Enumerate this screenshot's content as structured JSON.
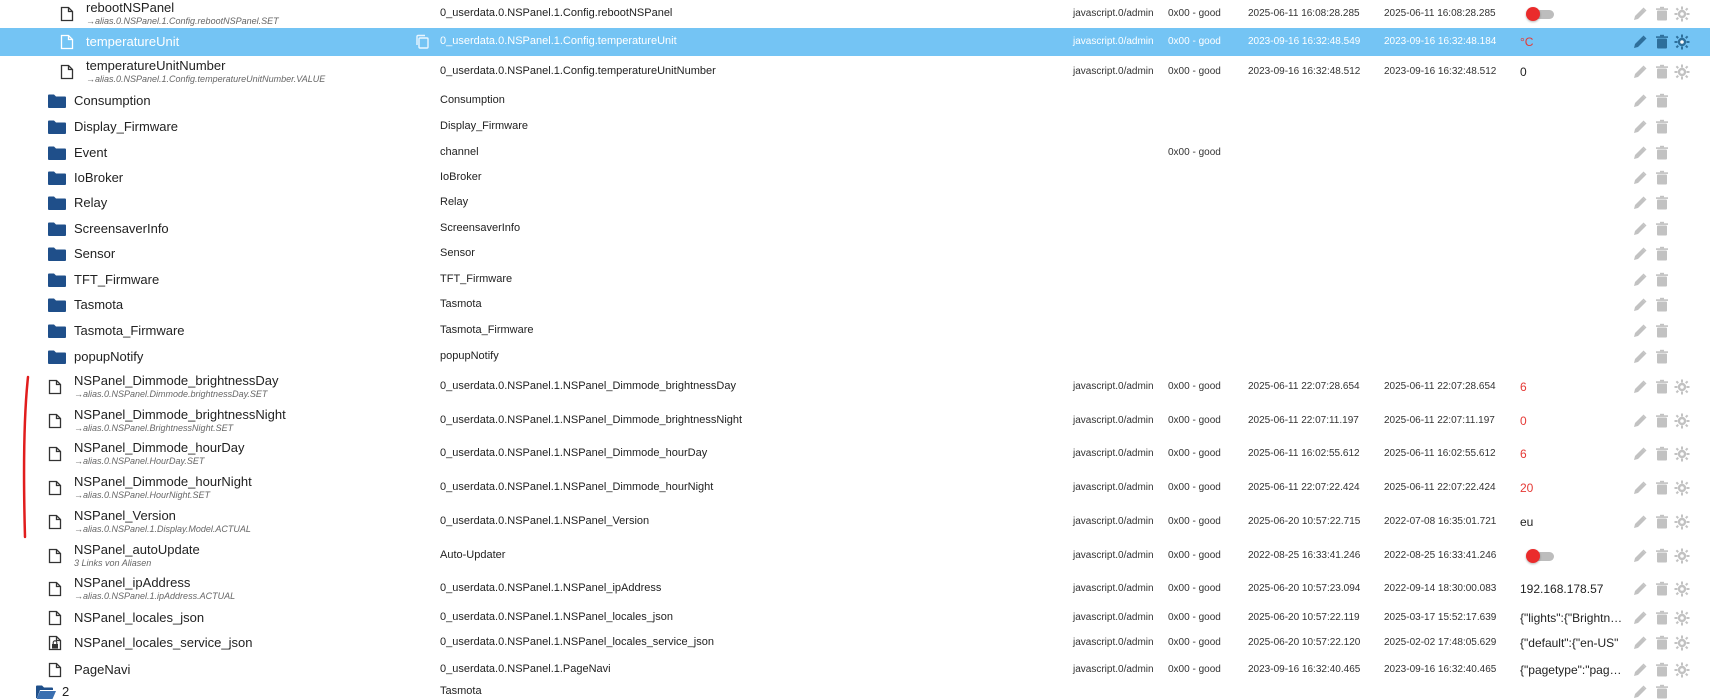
{
  "rows": [
    {
      "kind": "file",
      "level": 2,
      "name": "rebootNSPanel",
      "alias": "→alias.0.NSPanel.1.Config.rebootNSPanel.SET",
      "objid": "0_userdata.0.NSPanel.1.Config.rebootNSPanel",
      "user": "javascript.0/admin",
      "quality": "0x00 - good",
      "ts": "2025-06-11 16:08:28.285",
      "lc": "2025-06-11 16:08:28.285",
      "value": "",
      "value_type": "toggle",
      "cfg": true
    },
    {
      "kind": "file",
      "level": 2,
      "name": "temperatureUnit",
      "alias": "",
      "objid": "0_userdata.0.NSPanel.1.Config.temperatureUnit",
      "user": "javascript.0/admin",
      "quality": "0x00 - good",
      "ts": "2023-09-16 16:32:48.549",
      "lc": "2023-09-16 16:32:48.184",
      "value": "°C",
      "value_type": "red",
      "cfg": true,
      "selected": true
    },
    {
      "kind": "file",
      "level": 2,
      "name": "temperatureUnitNumber",
      "alias": "→alias.0.NSPanel.1.Config.temperatureUnitNumber.VALUE",
      "objid": "0_userdata.0.NSPanel.1.Config.temperatureUnitNumber",
      "user": "javascript.0/admin",
      "quality": "0x00 - good",
      "ts": "2023-09-16 16:32:48.512",
      "lc": "2023-09-16 16:32:48.512",
      "value": "0",
      "value_type": "plain",
      "cfg": true
    },
    {
      "kind": "folder",
      "level": 1,
      "name": "Consumption",
      "alias": "",
      "objid": "Consumption",
      "user": "",
      "quality": "",
      "ts": "",
      "lc": "",
      "value": "",
      "value_type": "none",
      "cfg": false
    },
    {
      "kind": "folder",
      "level": 1,
      "name": "Display_Firmware",
      "alias": "",
      "objid": "Display_Firmware",
      "user": "",
      "quality": "",
      "ts": "",
      "lc": "",
      "value": "",
      "value_type": "none",
      "cfg": false
    },
    {
      "kind": "folder",
      "level": 1,
      "name": "Event",
      "alias": "",
      "objid": "channel",
      "user": "",
      "quality": "0x00 - good",
      "ts": "",
      "lc": "",
      "value": "",
      "value_type": "none",
      "cfg": false
    },
    {
      "kind": "folder",
      "level": 1,
      "name": "IoBroker",
      "alias": "",
      "objid": "IoBroker",
      "user": "",
      "quality": "",
      "ts": "",
      "lc": "",
      "value": "",
      "value_type": "none",
      "cfg": false
    },
    {
      "kind": "folder",
      "level": 1,
      "name": "Relay",
      "alias": "",
      "objid": "Relay",
      "user": "",
      "quality": "",
      "ts": "",
      "lc": "",
      "value": "",
      "value_type": "none",
      "cfg": false
    },
    {
      "kind": "folder",
      "level": 1,
      "name": "ScreensaverInfo",
      "alias": "",
      "objid": "ScreensaverInfo",
      "user": "",
      "quality": "",
      "ts": "",
      "lc": "",
      "value": "",
      "value_type": "none",
      "cfg": false
    },
    {
      "kind": "folder",
      "level": 1,
      "name": "Sensor",
      "alias": "",
      "objid": "Sensor",
      "user": "",
      "quality": "",
      "ts": "",
      "lc": "",
      "value": "",
      "value_type": "none",
      "cfg": false
    },
    {
      "kind": "folder",
      "level": 1,
      "name": "TFT_Firmware",
      "alias": "",
      "objid": "TFT_Firmware",
      "user": "",
      "quality": "",
      "ts": "",
      "lc": "",
      "value": "",
      "value_type": "none",
      "cfg": false
    },
    {
      "kind": "folder",
      "level": 1,
      "name": "Tasmota",
      "alias": "",
      "objid": "Tasmota",
      "user": "",
      "quality": "",
      "ts": "",
      "lc": "",
      "value": "",
      "value_type": "none",
      "cfg": false
    },
    {
      "kind": "folder",
      "level": 1,
      "name": "Tasmota_Firmware",
      "alias": "",
      "objid": "Tasmota_Firmware",
      "user": "",
      "quality": "",
      "ts": "",
      "lc": "",
      "value": "",
      "value_type": "none",
      "cfg": false
    },
    {
      "kind": "folder",
      "level": 1,
      "name": "popupNotify",
      "alias": "",
      "objid": "popupNotify",
      "user": "",
      "quality": "",
      "ts": "",
      "lc": "",
      "value": "",
      "value_type": "none",
      "cfg": false
    },
    {
      "kind": "file",
      "level": 1,
      "name": "NSPanel_Dimmode_brightnessDay",
      "alias": "→alias.0.NSPanel.Dimmode.brightnessDay.SET",
      "objid": "0_userdata.0.NSPanel.1.NSPanel_Dimmode_brightnessDay",
      "user": "javascript.0/admin",
      "quality": "0x00 - good",
      "ts": "2025-06-11 22:07:28.654",
      "lc": "2025-06-11 22:07:28.654",
      "value": "6",
      "value_type": "red",
      "cfg": true
    },
    {
      "kind": "file",
      "level": 1,
      "name": "NSPanel_Dimmode_brightnessNight",
      "alias": "→alias.0.NSPanel.BrightnessNight.SET",
      "objid": "0_userdata.0.NSPanel.1.NSPanel_Dimmode_brightnessNight",
      "user": "javascript.0/admin",
      "quality": "0x00 - good",
      "ts": "2025-06-11 22:07:11.197",
      "lc": "2025-06-11 22:07:11.197",
      "value": "0",
      "value_type": "red",
      "cfg": true
    },
    {
      "kind": "file",
      "level": 1,
      "name": "NSPanel_Dimmode_hourDay",
      "alias": "→alias.0.NSPanel.HourDay.SET",
      "objid": "0_userdata.0.NSPanel.1.NSPanel_Dimmode_hourDay",
      "user": "javascript.0/admin",
      "quality": "0x00 - good",
      "ts": "2025-06-11 16:02:55.612",
      "lc": "2025-06-11 16:02:55.612",
      "value": "6",
      "value_type": "red",
      "cfg": true
    },
    {
      "kind": "file",
      "level": 1,
      "name": "NSPanel_Dimmode_hourNight",
      "alias": "→alias.0.NSPanel.HourNight.SET",
      "objid": "0_userdata.0.NSPanel.1.NSPanel_Dimmode_hourNight",
      "user": "javascript.0/admin",
      "quality": "0x00 - good",
      "ts": "2025-06-11 22:07:22.424",
      "lc": "2025-06-11 22:07:22.424",
      "value": "20",
      "value_type": "red",
      "cfg": true
    },
    {
      "kind": "file",
      "level": 1,
      "name": "NSPanel_Version",
      "alias": "→alias.0.NSPanel.1.Display.Model.ACTUAL",
      "objid": "0_userdata.0.NSPanel.1.NSPanel_Version",
      "user": "javascript.0/admin",
      "quality": "0x00 - good",
      "ts": "2025-06-20 10:57:22.715",
      "lc": "2022-07-08 16:35:01.721",
      "value": "eu",
      "value_type": "plain",
      "cfg": true
    },
    {
      "kind": "file",
      "level": 1,
      "name": "NSPanel_autoUpdate",
      "alias": "3 Links von Aliasen",
      "objid": "Auto-Updater",
      "user": "javascript.0/admin",
      "quality": "0x00 - good",
      "ts": "2022-08-25 16:33:41.246",
      "lc": "2022-08-25 16:33:41.246",
      "value": "",
      "value_type": "toggle",
      "cfg": true
    },
    {
      "kind": "file",
      "level": 1,
      "name": "NSPanel_ipAddress",
      "alias": "→alias.0.NSPanel.1.ipAddress.ACTUAL",
      "objid": "0_userdata.0.NSPanel.1.NSPanel_ipAddress",
      "user": "javascript.0/admin",
      "quality": "0x00 - good",
      "ts": "2025-06-20 10:57:23.094",
      "lc": "2022-09-14 18:30:00.083",
      "value": "192.168.178.57",
      "value_type": "plain",
      "cfg": true
    },
    {
      "kind": "file",
      "level": 1,
      "name": "NSPanel_locales_json",
      "alias": "",
      "objid": "0_userdata.0.NSPanel.1.NSPanel_locales_json",
      "user": "javascript.0/admin",
      "quality": "0x00 - good",
      "ts": "2025-06-20 10:57:22.119",
      "lc": "2025-03-17 15:52:17.639",
      "value": "{\"lights\":{\"Brightness",
      "value_type": "plain",
      "cfg": true
    },
    {
      "kind": "file-lock",
      "level": 1,
      "name": "NSPanel_locales_service_json",
      "alias": "",
      "objid": "0_userdata.0.NSPanel.1.NSPanel_locales_service_json",
      "user": "javascript.0/admin",
      "quality": "0x00 - good",
      "ts": "2025-06-20 10:57:22.120",
      "lc": "2025-02-02 17:48:05.629",
      "value": "{\"default\":{\"en-US\"",
      "value_type": "plain",
      "cfg": true
    },
    {
      "kind": "file",
      "level": 1,
      "name": "PageNavi",
      "alias": "",
      "objid": "0_userdata.0.NSPanel.1.PageNavi",
      "user": "javascript.0/admin",
      "quality": "0x00 - good",
      "ts": "2023-09-16 16:32:40.465",
      "lc": "2023-09-16 16:32:40.465",
      "value": "{\"pagetype\":\"pageItem",
      "value_type": "plain",
      "cfg": true
    },
    {
      "kind": "folder-open",
      "level": 0,
      "name": "2",
      "alias": "",
      "objid": "Tasmota",
      "user": "",
      "quality": "",
      "ts": "",
      "lc": "",
      "value": "",
      "value_type": "none",
      "cfg": false
    }
  ],
  "colors": {
    "selected_row": "#74c4f4",
    "folder": "#1f4f8a",
    "toggle_knob": "#ea2b2b",
    "red_value": "#e53935",
    "annotation_marker": "#e11d1d"
  },
  "icons": {
    "file": "file-icon",
    "folder": "folder-icon",
    "folder_open": "folder-open-icon",
    "file_lock": "file-lock-icon",
    "copy": "copy-icon",
    "edit": "pencil-icon",
    "delete": "trash-icon",
    "config": "gear-icon"
  }
}
